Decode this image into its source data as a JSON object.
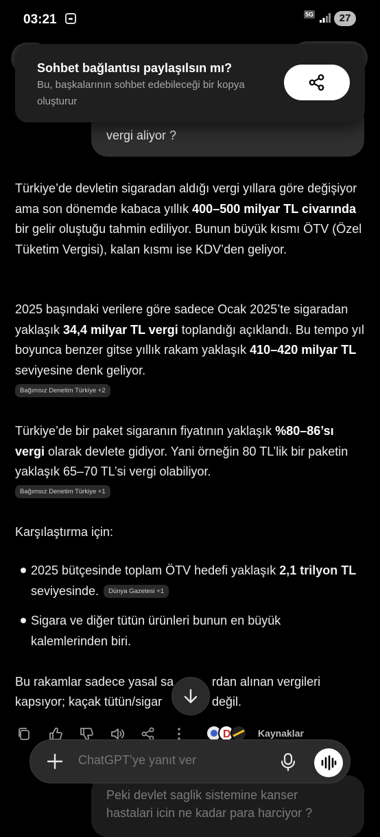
{
  "status_bar": {
    "time": "03:21",
    "network": "5G",
    "battery": "27",
    "icons": [
      "screen-record-icon",
      "signal-icon",
      "battery-icon"
    ]
  },
  "share_popup": {
    "title": "Sohbet bağlantısı paylaşılsın mı?",
    "description": "Bu, başkalarının sohbet edebileceği bir kopya oluşturur",
    "button_icon": "share-icon"
  },
  "user_message": {
    "visible_text": "vergi aliyor ?"
  },
  "answer": {
    "p1": {
      "a": "Türkiye’de devletin sigaradan aldığı vergi yıllara göre değişiyor ama son dönemde kabaca yıllık ",
      "b": "400–500 milyar TL civarında",
      "c": " bir gelir oluştuğu tahmin ediliyor. Bunun büyük kısmı ÖTV (Özel Tüketim Vergisi), kalan kısmı ise KDV’den geliyor."
    },
    "p2": {
      "a": "2025 başındaki verilere göre sadece Ocak 2025’te sigaradan yaklaşık ",
      "b": "34,4 milyar TL vergi",
      "c": " toplandığı açıklandı. Bu tempo yıl boyunca benzer gitse yıllık rakam yaklaşık ",
      "d": "410–420 milyar TL",
      "e": " seviyesine denk geliyor.",
      "source": "Bağımsız Denetim Türkiye +2"
    },
    "p3": {
      "a": "Türkiye’de bir paket sigaranın fiyatının yaklaşık ",
      "b": "%80–86’sı vergi",
      "c": " olarak devlete gidiyor. Yani örneğin 80 TL’lik bir paketin yaklaşık 65–70 TL’si vergi olabiliyor.",
      "source": "Bağımsız Denetim Türkiye +1"
    },
    "p4": "Karşılaştırma için:",
    "bullets": [
      {
        "a": "2025 bütçesinde toplam ÖTV hedefi yaklaşık ",
        "b": "2,1 trilyon TL",
        "c": " seviyesinde. ",
        "source": "Dünya Gazetesi +1"
      },
      {
        "a": "Sigara ve diğer tütün ürünleri bunun en büyük kalemlerinden biri."
      }
    ],
    "p5_line1_left": "Bu rakamlar sadece yasal sa",
    "p5_line1_right": "rdan alınan vergileri",
    "p5_line2_left": "kapsıyor; kaçak tütün/sigar",
    "p5_line2_right": "değil."
  },
  "actions": {
    "icons": [
      "copy-icon",
      "thumbs-up-icon",
      "thumbs-down-icon",
      "read-aloud-icon",
      "share-icon",
      "more-icon"
    ],
    "sources_label": "Kaynaklar"
  },
  "next_user_message": {
    "text": "Peki devlet saglik sistemine kanser hastalari icin ne kadar para harciyor ?"
  },
  "composer": {
    "placeholder": "ChatGPT’ye yanıt ver"
  },
  "colors": {
    "background": "#000000",
    "bubble": "#2f2f2f",
    "popup": "#1f1f1f",
    "text": "#ececec",
    "muted": "#a8a8a8"
  }
}
